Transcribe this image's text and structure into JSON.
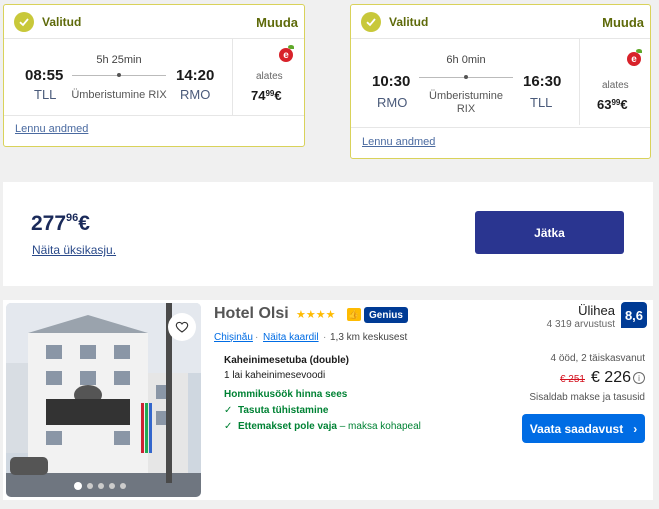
{
  "outbound": {
    "status": "Valitud",
    "change": "Muuda",
    "depart_time": "08:55",
    "depart_code": "TLL",
    "duration": "5h 25min",
    "stopover": "Ümberistumine RIX",
    "arrive_time": "14:20",
    "arrive_code": "RMO",
    "from_label": "alates",
    "price_main": "74",
    "price_cents": "99",
    "price_currency": "€",
    "details_link": "Lennu andmed"
  },
  "return": {
    "status": "Valitud",
    "change": "Muuda",
    "depart_time": "10:30",
    "depart_code": "RMO",
    "duration": "6h 0min",
    "stopover_line1": "Ümberistumine",
    "stopover_line2": "RIX",
    "arrive_time": "16:30",
    "arrive_code": "TLL",
    "from_label": "alates",
    "price_main": "63",
    "price_cents": "99",
    "price_currency": "€",
    "details_link": "Lennu andmed"
  },
  "summary": {
    "total_main": "277",
    "total_cents": "96",
    "total_currency": "€",
    "single_price_link": "Näita üksikasju.",
    "continue_button": "Jätka"
  },
  "hotel": {
    "name": "Hotel Olsi",
    "stars": "★★★★",
    "genius_badge": "Genius",
    "city_link": "Chișinău",
    "map_link": "Näita kaardil",
    "distance": "1,3 km keskusest",
    "rating_word": "Ülihea",
    "reviews": "4 319 arvustust",
    "score": "8,6",
    "room_type": "Kaheinimesetuba (double)",
    "bed": "1 lai kaheinimesevoodi",
    "breakfast": "Hommikusöök hinna sees",
    "perk1": "Tasuta tühistamine",
    "perk2_bold": "Ettemakset pole vaja",
    "perk2_rest": " – maksa kohapeal",
    "nights": "4 ööd, 2 täiskasvanut",
    "old_price": "€ 251",
    "new_price": "€ 226",
    "taxes": "Sisaldab makse ja tasusid",
    "see_button": "Vaata saadavust"
  },
  "colors": {
    "selected_accent": "#c8c83a",
    "primary_blue": "#003b95",
    "action_blue": "#006ce4",
    "green": "#008234",
    "strike_red": "#d4111e",
    "continue_button": "#2a3590"
  }
}
